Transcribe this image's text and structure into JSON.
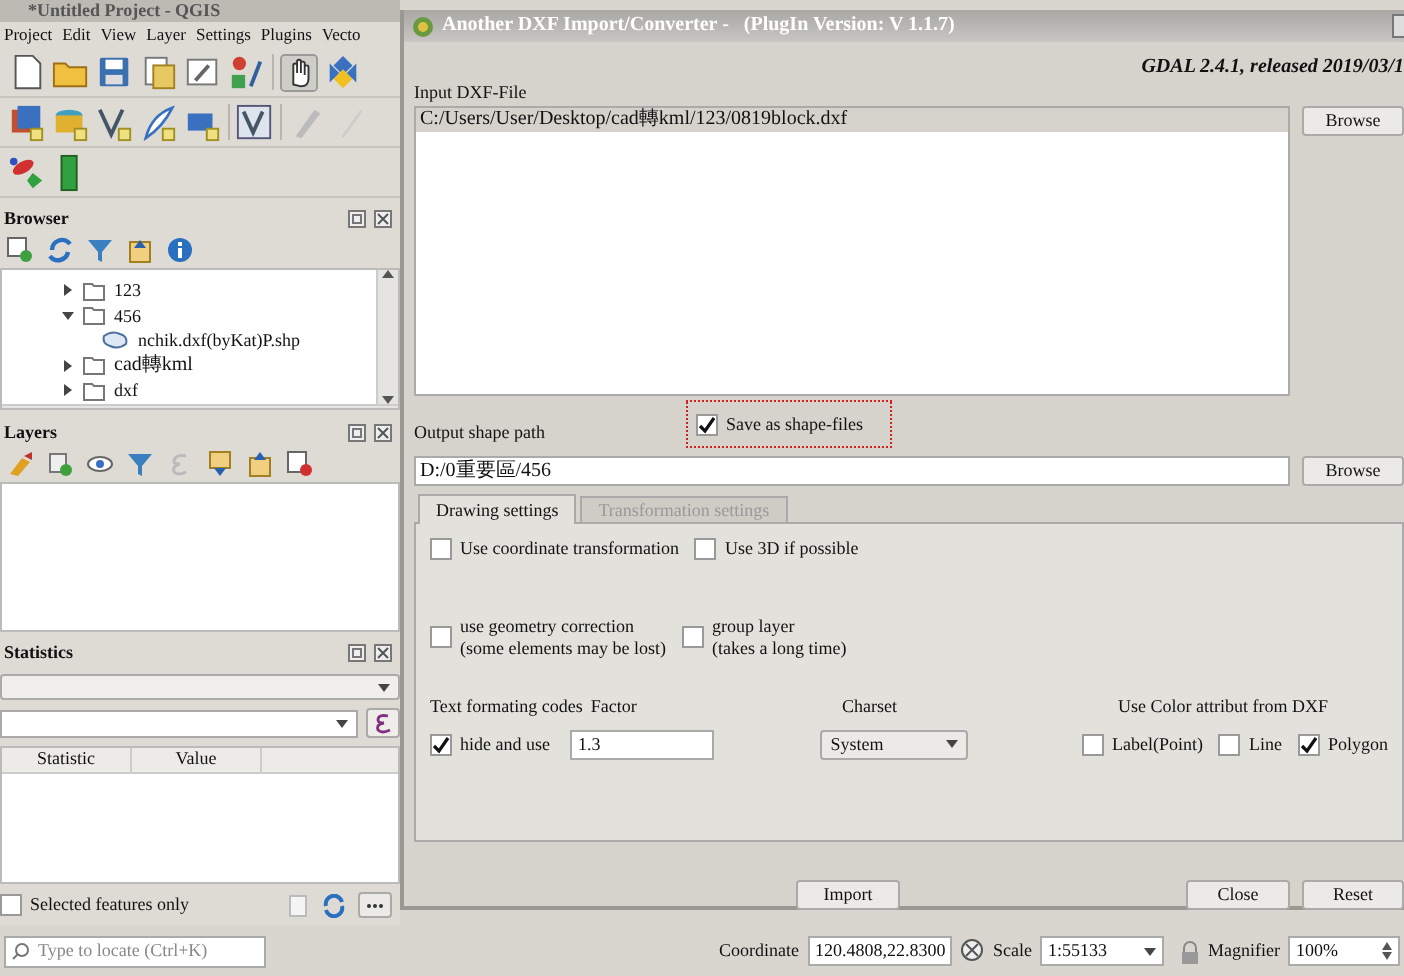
{
  "qgis": {
    "title": "*Untitled Project - QGIS",
    "menu": [
      "Project",
      "Edit",
      "View",
      "Layer",
      "Settings",
      "Plugins",
      "Vecto"
    ]
  },
  "browser": {
    "title": "Browser",
    "tree": [
      {
        "label": "123",
        "expanded": false
      },
      {
        "label": "456",
        "expanded": true,
        "children": [
          {
            "label": "nchik.dxf(byKat)P.shp"
          }
        ]
      },
      {
        "label": "cad轉kml",
        "expanded": false
      },
      {
        "label": "dxf",
        "expanded": false
      }
    ]
  },
  "layers": {
    "title": "Layers"
  },
  "statistics": {
    "title": "Statistics",
    "columns": [
      "Statistic",
      "Value"
    ],
    "selected_only": {
      "label": "Selected features only",
      "checked": false
    }
  },
  "locator": {
    "placeholder": "Type to locate (Ctrl+K)"
  },
  "dialog": {
    "title": "Another DXF Import/Converter -   (PlugIn Version: V 1.1.7)",
    "gdal": "GDAL 2.4.1, released 2019/03/1",
    "input": {
      "label": "Input DXF-File",
      "files": [
        {
          "path": "C:/Users/User/Desktop/cad轉kml/123/0819block.dxf",
          "selected": true
        }
      ],
      "button": "Browse"
    },
    "output": {
      "label": "Output shape path",
      "save_shape": {
        "label": "Save as shape-files",
        "checked": true
      },
      "value": "D:/0重要區/456",
      "button": "Browse"
    },
    "tabs": [
      {
        "label": "Drawing settings",
        "selected": true,
        "disabled": false
      },
      {
        "label": "Transformation settings",
        "selected": false,
        "disabled": true
      }
    ],
    "options": [
      {
        "label": "Use coordinate transformation",
        "checked": false
      },
      {
        "label": "Use 3D if possible",
        "checked": false
      }
    ],
    "options2": [
      {
        "label": "use geometry correction\n(some elements may be lost)",
        "checked": false
      },
      {
        "label": "group layer\n(takes a long time)",
        "checked": false
      }
    ],
    "text_codes": {
      "label": "Text formating codes",
      "checkbox": {
        "label": "hide and use",
        "checked": true
      }
    },
    "factor": {
      "label": "Factor",
      "value": "1.3"
    },
    "charset": {
      "label": "Charset",
      "value": "System"
    },
    "color_attr": {
      "label": "Use Color attribut from DXF",
      "options": [
        {
          "label": "Label(Point)",
          "checked": false
        },
        {
          "label": "Line",
          "checked": false
        },
        {
          "label": "Polygon",
          "checked": true
        }
      ]
    },
    "buttons": [
      "Import",
      "Close",
      "Reset"
    ]
  },
  "status_bar": {
    "coordinate_label": "Coordinate",
    "coordinate": "120.4808,22.8300",
    "scale_label": "Scale",
    "scale": "1:55133",
    "magnifier_label": "Magnifier",
    "magnifier": "100%"
  }
}
